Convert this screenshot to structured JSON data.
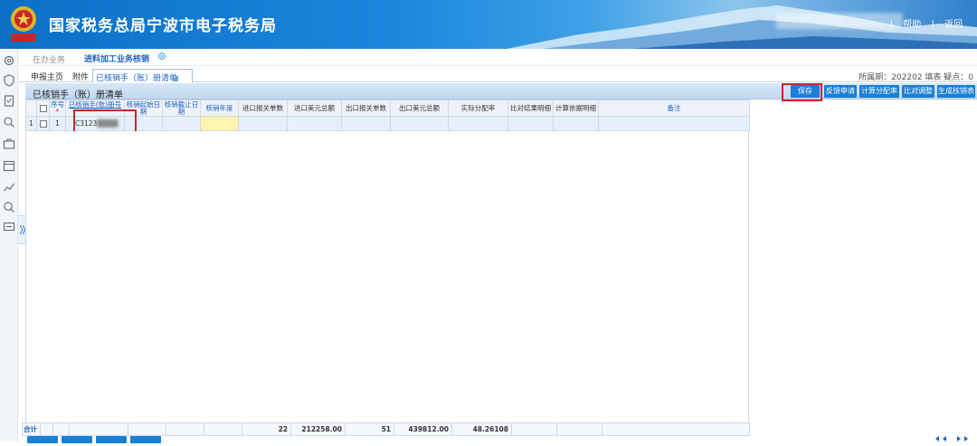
{
  "header": {
    "title": "国家税务总局宁波市电子税务局",
    "links": [
      "帮助",
      "返回"
    ]
  },
  "topnav": {
    "tab1": "在办业务",
    "tab2": "进料加工业务核销"
  },
  "subnav": {
    "items": [
      "申报主页",
      "附件"
    ],
    "active": "已核销手（账）册清单",
    "period": "所属期：202202  填表  疑点：0"
  },
  "grid_title": "已核销手（账）册清单",
  "buttons": {
    "save": "保存",
    "b2": "反馈申请",
    "b3": "计算分配率",
    "b4": "比对调整",
    "b5": "生成核销表"
  },
  "columns": [
    "序号",
    "已核销手(账)册号",
    "核销起始日期",
    "核销截止日期",
    "核销年度",
    "进口报关单数",
    "进口美元总额",
    "出口报关单数",
    "出口美元总额",
    "实际分配率",
    "比对结果明细",
    "计算依据明细",
    "备注"
  ],
  "row": {
    "rownum": "1",
    "seq": "1",
    "book_no": "C3123"
  },
  "totals": {
    "label": "合计",
    "import_count": "22",
    "import_usd": "212258.00",
    "export_count": "51",
    "export_usd": "439812.00",
    "rate": "48.26108"
  }
}
